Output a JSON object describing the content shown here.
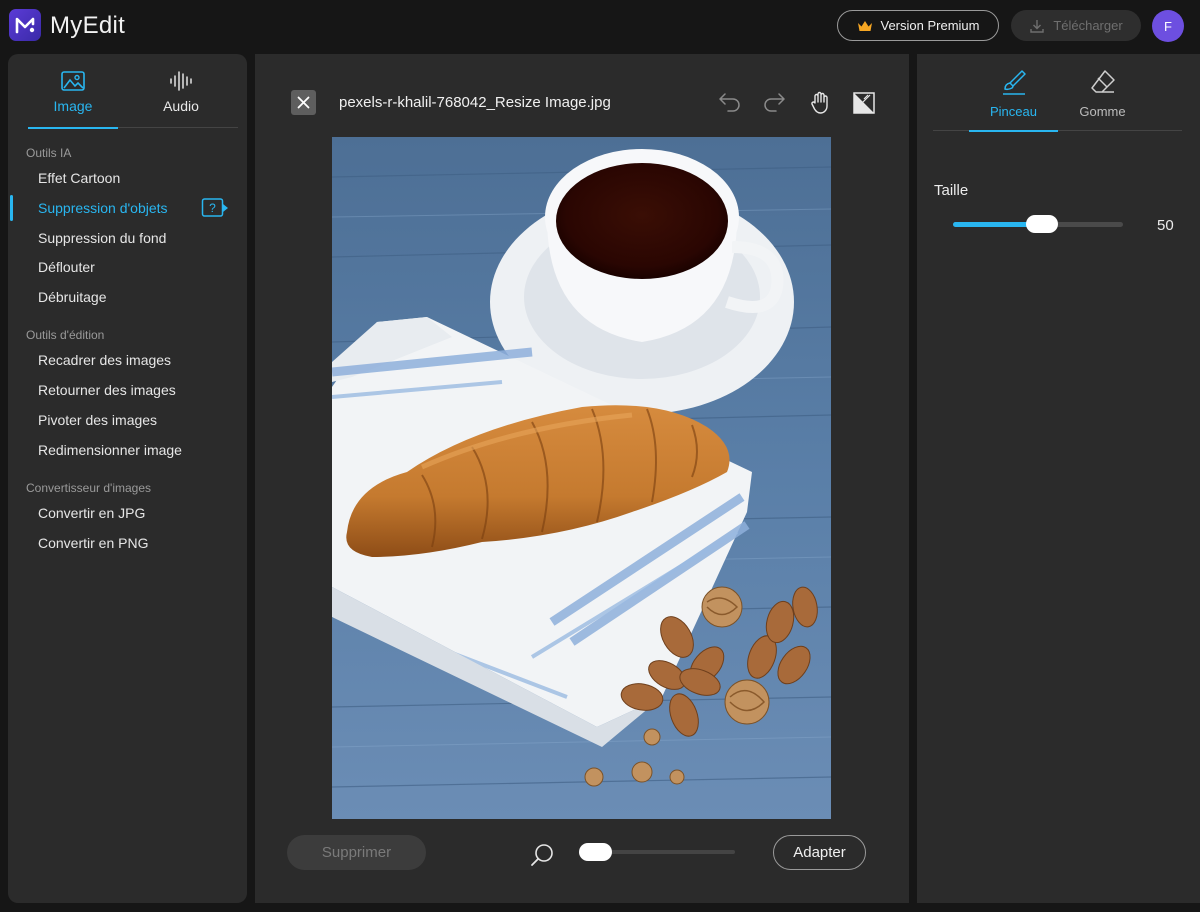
{
  "app": {
    "brand": "MyEdit",
    "accent": "#29b6f0",
    "logo_color": "#5b3bd6"
  },
  "header": {
    "premium_label": "Version Premium",
    "download_label": "Télécharger",
    "avatar_initial": "F"
  },
  "sidebar": {
    "tabs": [
      {
        "label": "Image",
        "icon": "image-icon",
        "active": true
      },
      {
        "label": "Audio",
        "icon": "audio-waveform-icon",
        "active": false
      }
    ],
    "sections": [
      {
        "title": "Outils IA",
        "items": [
          {
            "label": "Effet Cartoon"
          },
          {
            "label": "Suppression d'objets",
            "active": true
          },
          {
            "label": "Suppression du fond"
          },
          {
            "label": "Déflouter"
          },
          {
            "label": "Débruitage"
          }
        ]
      },
      {
        "title": "Outils d'édition",
        "items": [
          {
            "label": "Recadrer des images"
          },
          {
            "label": "Retourner des images"
          },
          {
            "label": "Pivoter des images"
          },
          {
            "label": "Redimensionner image"
          }
        ]
      },
      {
        "title": "Convertisseur d'images",
        "items": [
          {
            "label": "Convertir en JPG"
          },
          {
            "label": "Convertir en PNG"
          }
        ]
      }
    ]
  },
  "editor": {
    "filename": "pexels-r-khalil-768042_Resize Image.jpg",
    "delete_label": "Supprimer",
    "fit_label": "Adapter",
    "zoom_level": 0
  },
  "brush": {
    "tabs": [
      {
        "label": "Pinceau",
        "icon": "brush-icon",
        "active": true
      },
      {
        "label": "Gomme",
        "icon": "eraser-icon",
        "active": false
      }
    ],
    "size_label": "Taille",
    "size_value": "50",
    "size_fraction": 0.5
  }
}
